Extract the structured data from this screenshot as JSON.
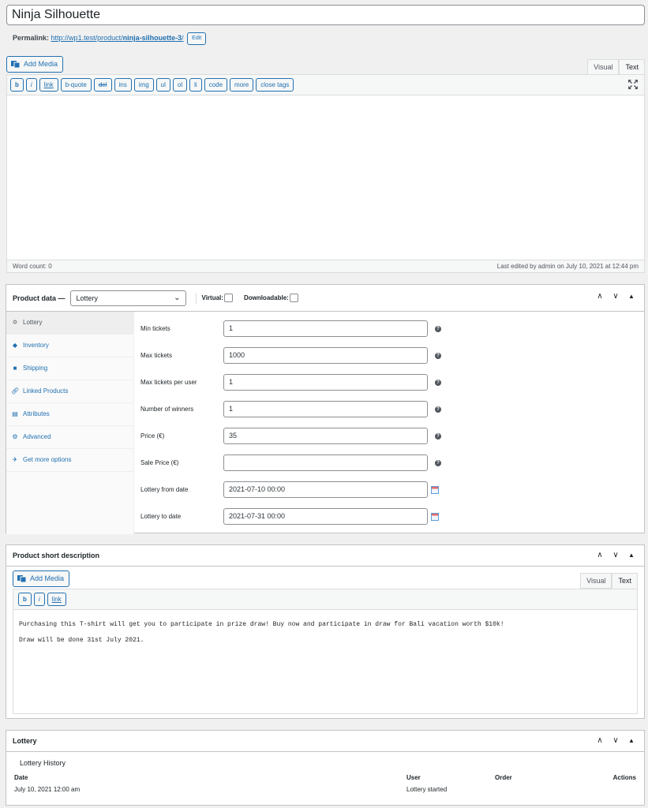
{
  "post": {
    "title": "Ninja Silhouette",
    "permalink_label": "Permalink:",
    "permalink_base": "http://wp1.test/product/",
    "permalink_slug": "ninja-silhouette-3",
    "permalink_tail": "/",
    "edit_label": "Edit"
  },
  "editor": {
    "add_media_label": "Add Media",
    "tab_visual": "Visual",
    "tab_text": "Text",
    "buttons": [
      "b",
      "i",
      "link",
      "b-quote",
      "del",
      "ins",
      "img",
      "ul",
      "ol",
      "li",
      "code",
      "more",
      "close tags"
    ],
    "word_count": "Word count: 0",
    "last_edited": "Last edited by admin on July 10, 2021 at 12:44 pm"
  },
  "product_data": {
    "title": "Product data —",
    "type_value": "Lottery",
    "virtual_label": "Virtual:",
    "downloadable_label": "Downloadable:",
    "tabs": [
      {
        "label": "Lottery",
        "icon": "ticket-icon"
      },
      {
        "label": "Inventory",
        "icon": "tag-icon"
      },
      {
        "label": "Shipping",
        "icon": "truck-icon"
      },
      {
        "label": "Linked Products",
        "icon": "link-icon"
      },
      {
        "label": "Attributes",
        "icon": "table-icon"
      },
      {
        "label": "Advanced",
        "icon": "gear-icon"
      },
      {
        "label": "Get more options",
        "icon": "plugin-icon"
      }
    ],
    "fields": [
      {
        "label": "Min tickets",
        "value": "1",
        "help": true
      },
      {
        "label": "Max tickets",
        "value": "1000",
        "help": true
      },
      {
        "label": "Max tickets per user",
        "value": "1",
        "help": true
      },
      {
        "label": "Number of winners",
        "value": "1",
        "help": true
      },
      {
        "label": "Price (€)",
        "value": "35",
        "help": true
      },
      {
        "label": "Sale Price (€)",
        "value": "",
        "help": true
      },
      {
        "label": "Lottery from date",
        "value": "2021-07-10 00:00",
        "help": false
      },
      {
        "label": "Lottery to date",
        "value": "2021-07-31 00:00",
        "help": false
      }
    ]
  },
  "short_description": {
    "title": "Product short description",
    "add_media_label": "Add Media",
    "tab_visual": "Visual",
    "tab_text": "Text",
    "buttons": [
      "b",
      "i",
      "link"
    ],
    "paragraphs": [
      "Purchasing this T-shirt will get you to participate in prize draw! Buy now and participate in draw for Bali vacation worth $10k!",
      "Draw will be done 31st July 2021."
    ]
  },
  "lottery": {
    "title": "Lottery",
    "subtitle": "Lottery History",
    "columns": [
      "Date",
      "User",
      "Order",
      "Actions"
    ],
    "rows": [
      {
        "date": "July 10, 2021 12:00 am",
        "user": "Lottery started",
        "order": "",
        "actions": ""
      }
    ]
  },
  "colors": {
    "accent": "#2271b1",
    "border": "#c3c4c7",
    "background": "#f0f0f1"
  }
}
